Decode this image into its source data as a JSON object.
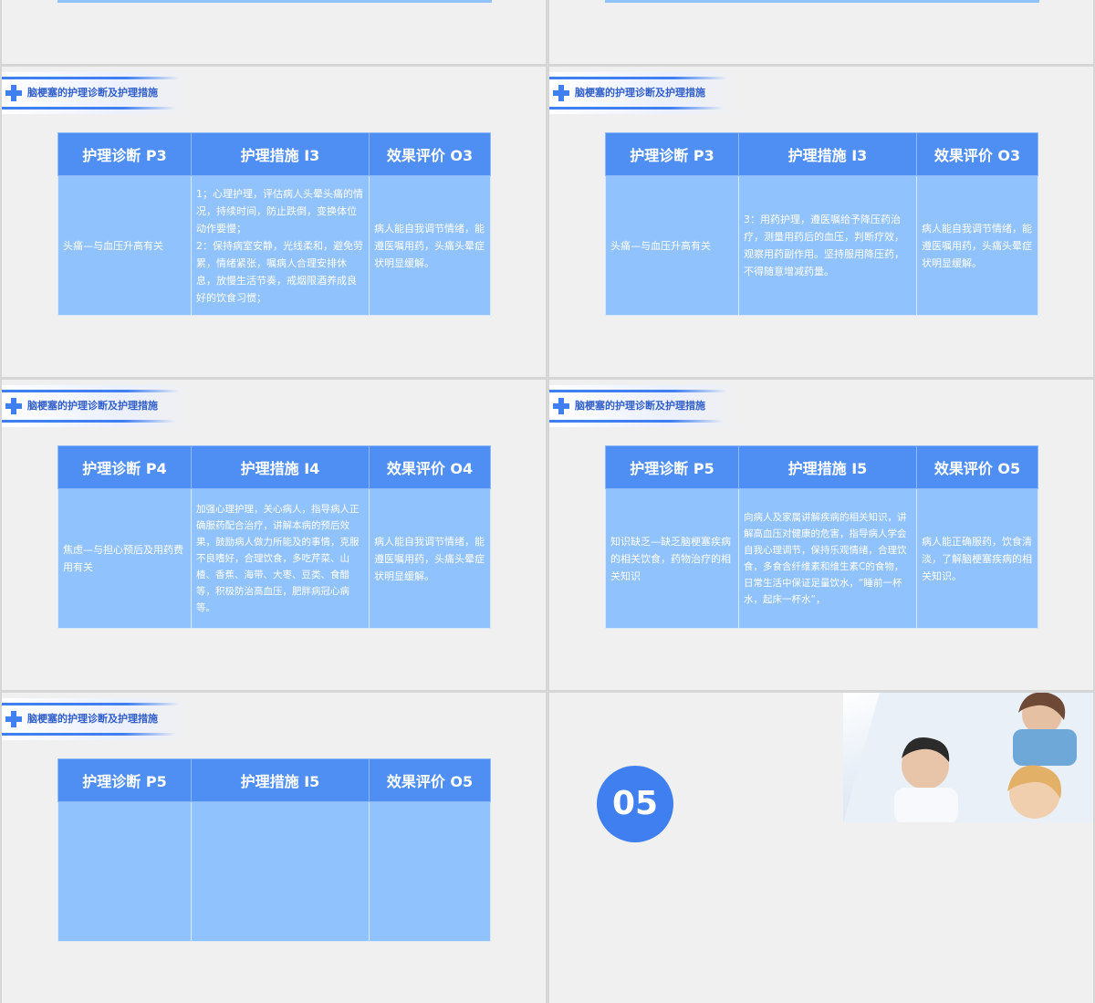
{
  "header_title": "脑梗塞的护理诊断及护理措施",
  "table_headers": {
    "p3": [
      "护理诊断  P3",
      "护理措施  I3",
      "效果评价  O3"
    ],
    "p4": [
      "护理诊断  P4",
      "护理措施  I4",
      "效果评价  O4"
    ],
    "p5": [
      "护理诊断  P5",
      "护理措施  I5",
      "效果评价  O5"
    ]
  },
  "slides": [
    {
      "diag": "头痛—与血压升高有关",
      "measures": "1；心理护理，评估病人头晕头痛的情况，持续时间，防止跌倒，变换体位动作要慢；\n2：保持病室安静，光线柔和，避免劳累，情绪紧张，嘱病人合理安排休息，放慢生活节奏，戒烟限酒养成良好的饮食习惯；",
      "eval": "病人能自我调节情绪，能遵医嘱用药，头痛头晕症状明显缓解。"
    },
    {
      "diag": "头痛—与血压升高有关",
      "measures": "3：用药护理，遵医嘱给予降压药治疗，测量用药后的血压，判断疗效，观察用药副作用。坚持服用降压药，不得随意增减药量。",
      "eval": "病人能自我调节情绪，能遵医嘱用药，头痛头晕症状明显缓解。"
    },
    {
      "diag": "焦虑—与担心预后及用药费用有关",
      "measures": "加强心理护理，关心病人，指导病人正确服药配合治疗，讲解本病的预后效果，鼓励病人做力所能及的事情，克服不良嗜好，合理饮食，多吃芹菜、山楂、香蕉、海带、大枣、豆类、食醋等，积极防治高血压，肥胖病冠心病等。",
      "eval": "病人能自我调节情绪，能遵医嘱用药，头痛头晕症状明显缓解。"
    },
    {
      "diag": "知识缺乏—缺乏脑梗塞疾病的相关饮食，药物治疗的相关知识",
      "measures": "向病人及家属讲解疾病的相关知识，讲解高血压对健康的危害，指导病人学会自我心理调节，保持乐观情绪，合理饮食，多食含纤维素和维生素C的食物，日常生活中保证足量饮水，“睡前一杯水，起床一杯水”，",
      "eval": "病人能正确服药，饮食清淡，了解脑梗塞疾病的相关知识。"
    }
  ],
  "section_number": "05",
  "colors": {
    "accent": "#3f7ff0",
    "header_cell": "#4f8ef2",
    "body_cell": "#90c2fd"
  }
}
